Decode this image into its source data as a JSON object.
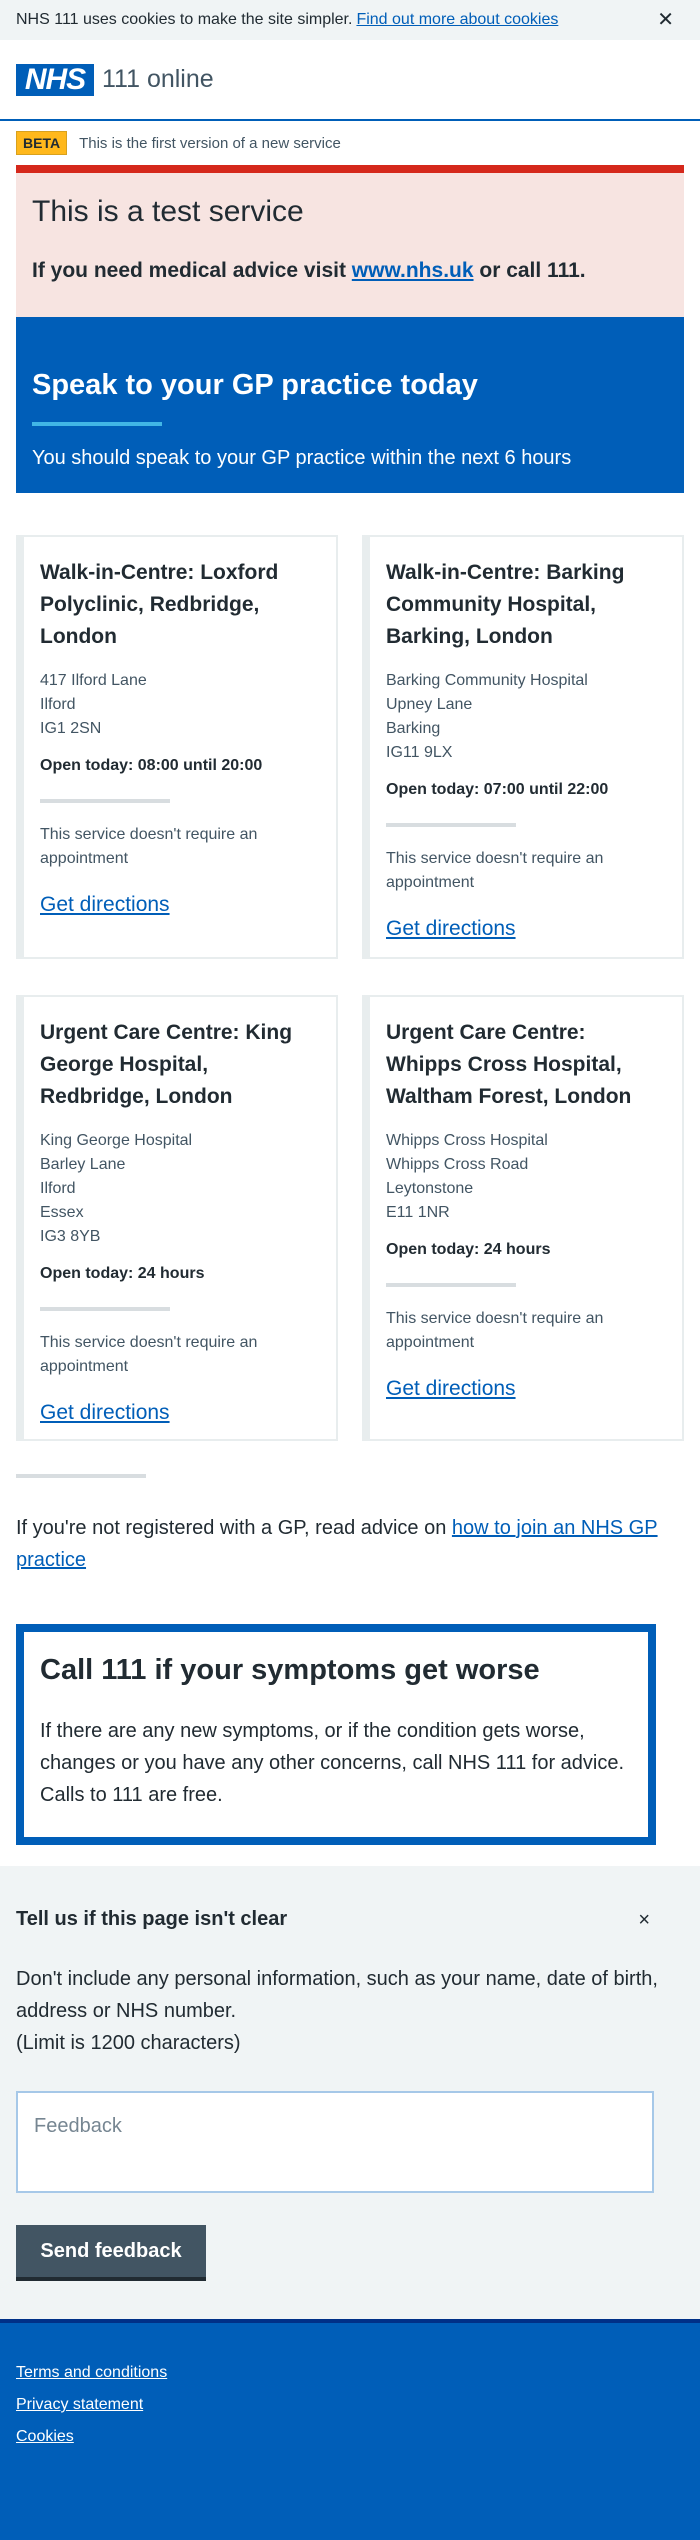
{
  "cookie_banner": {
    "text": "NHS 111 uses cookies to make the site simpler.",
    "link": "Find out more about cookies",
    "close": "✕"
  },
  "header": {
    "logo": "NHS",
    "service_name": "111 online"
  },
  "beta": {
    "tag": "BETA",
    "text": "This is the first version of a new service"
  },
  "test_panel": {
    "heading": "This is a test service",
    "text_before": "If you need medical advice visit ",
    "link": "www.nhs.uk",
    "text_after": " or call 111."
  },
  "banner": {
    "heading": "Speak to your GP practice today",
    "subtext": "You should speak to your GP practice within the next 6 hours"
  },
  "services": [
    {
      "name": "Walk-in-Centre: Loxford Polyclinic, Redbridge, London",
      "address": [
        "417 Ilford Lane",
        "Ilford",
        "IG1 2SN"
      ],
      "opening": "Open today: 08:00 until 20:00",
      "appointment": "This service doesn't require an appointment",
      "directions": "Get directions"
    },
    {
      "name": "Walk-in-Centre: Barking Community Hospital, Barking, London",
      "address": [
        "Barking Community Hospital",
        "Upney Lane",
        "Barking",
        "IG11 9LX"
      ],
      "opening": "Open today: 07:00 until 22:00",
      "appointment": "This service doesn't require an appointment",
      "directions": "Get directions"
    },
    {
      "name": "Urgent Care Centre: King George Hospital, Redbridge, London",
      "address": [
        "King George Hospital",
        "Barley Lane",
        "Ilford",
        "Essex",
        "IG3 8YB"
      ],
      "opening": "Open today: 24 hours",
      "appointment": "This service doesn't require an appointment",
      "directions": "Get directions"
    },
    {
      "name": "Urgent Care Centre: Whipps Cross Hospital, Waltham Forest, London",
      "address": [
        "Whipps Cross Hospital",
        "Whipps Cross Road",
        "Leytonstone",
        "E11 1NR"
      ],
      "opening": "Open today: 24 hours",
      "appointment": "This service doesn't require an appointment",
      "directions": "Get directions"
    }
  ],
  "gp_advice": {
    "text": "If you're not registered with a GP, read advice on ",
    "link": "how to join an NHS GP practice"
  },
  "call_box": {
    "heading": "Call 111 if your symptoms get worse",
    "text": "If there are any new symptoms, or if the condition gets worse, changes or you have any other concerns, call NHS 111 for advice. Calls to 111 are free."
  },
  "feedback": {
    "heading": "Tell us if this page isn't clear",
    "close": "×",
    "info": "Don't include any personal information, such as your name, date of birth, address or NHS number.",
    "limit": "(Limit is 1200 characters)",
    "placeholder": "Feedback",
    "value": "",
    "button": "Send feedback"
  },
  "footer": {
    "links": [
      "Terms and conditions",
      "Privacy statement",
      "Cookies"
    ]
  },
  "colors": {
    "nhs_blue": "#005eb8",
    "warning_red": "#d5281b",
    "beta_yellow": "#ffb81c",
    "grey_background": "#f0f4f5",
    "button_grey": "#425563"
  }
}
